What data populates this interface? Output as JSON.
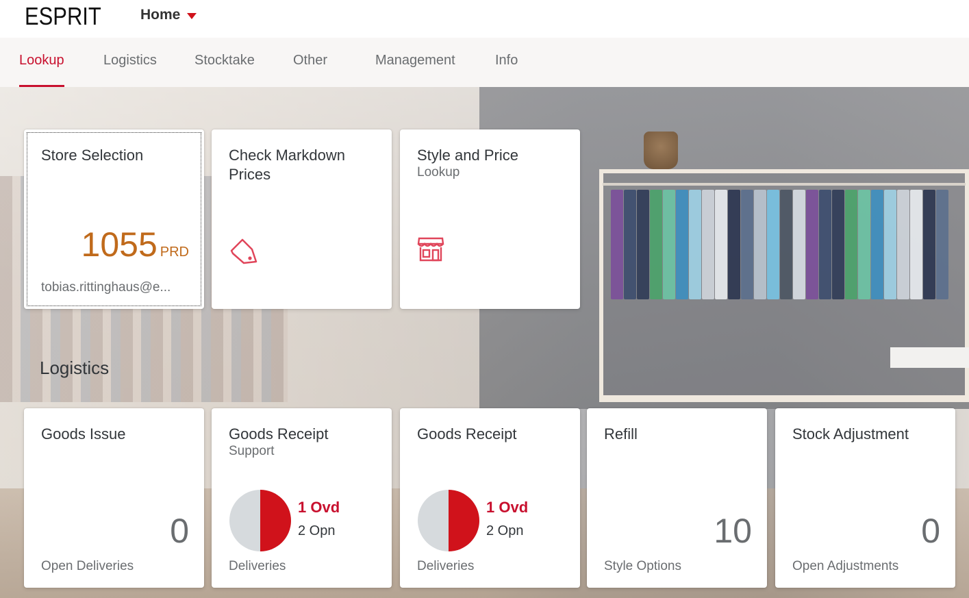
{
  "header": {
    "logo": "ESPRIT",
    "home_label": "Home"
  },
  "tabs": [
    {
      "label": "Lookup",
      "active": true
    },
    {
      "label": "Logistics",
      "active": false
    },
    {
      "label": "Stocktake",
      "active": false
    },
    {
      "label": "Other",
      "active": false
    },
    {
      "label": "Management",
      "active": false
    },
    {
      "label": "Info",
      "active": false
    }
  ],
  "lookup_tiles": {
    "store_selection": {
      "title": "Store Selection",
      "kpi_value": "1055",
      "kpi_scale": "PRD",
      "footer": "tobias.rittinghaus@e..."
    },
    "check_markdown": {
      "title": "Check Markdown Prices",
      "icon": "price-tag-icon"
    },
    "style_price": {
      "title": "Style and Price",
      "subtitle": "Lookup",
      "icon": "store-icon"
    }
  },
  "logistics_section": {
    "title": "Logistics",
    "tiles": {
      "goods_issue": {
        "title": "Goods Issue",
        "kpi_value": "0",
        "footer": "Open Deliveries"
      },
      "goods_receipt_support": {
        "title": "Goods Receipt",
        "subtitle": "Support",
        "overdue": "1 Ovd",
        "open": "2 Opn",
        "footer": "Deliveries",
        "fraction_overdue": 0.5
      },
      "goods_receipt": {
        "title": "Goods Receipt",
        "overdue": "1 Ovd",
        "open": "2 Opn",
        "footer": "Deliveries",
        "fraction_overdue": 0.5
      },
      "refill": {
        "title": "Refill",
        "kpi_value": "10",
        "footer": "Style Options"
      },
      "stock_adjustment": {
        "title": "Stock Adjustment",
        "kpi_value": "0",
        "footer": "Open Adjustments"
      }
    }
  },
  "colors": {
    "accent": "#c8102e",
    "kpi_orange": "#c06a1b",
    "text_primary": "#32363a",
    "text_secondary": "#6a6d70"
  }
}
